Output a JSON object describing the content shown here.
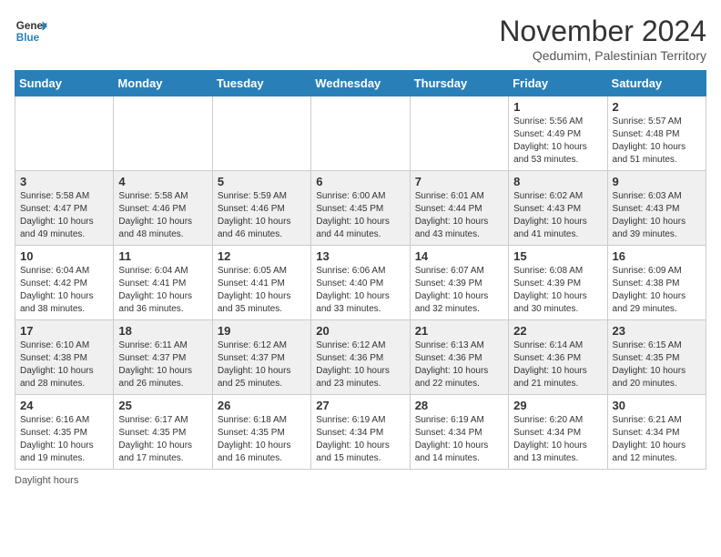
{
  "header": {
    "logo_general": "General",
    "logo_blue": "Blue",
    "month_year": "November 2024",
    "location": "Qedumim, Palestinian Territory"
  },
  "days_of_week": [
    "Sunday",
    "Monday",
    "Tuesday",
    "Wednesday",
    "Thursday",
    "Friday",
    "Saturday"
  ],
  "weeks": [
    [
      {
        "day": "",
        "info": ""
      },
      {
        "day": "",
        "info": ""
      },
      {
        "day": "",
        "info": ""
      },
      {
        "day": "",
        "info": ""
      },
      {
        "day": "",
        "info": ""
      },
      {
        "day": "1",
        "info": "Sunrise: 5:56 AM\nSunset: 4:49 PM\nDaylight: 10 hours\nand 53 minutes."
      },
      {
        "day": "2",
        "info": "Sunrise: 5:57 AM\nSunset: 4:48 PM\nDaylight: 10 hours\nand 51 minutes."
      }
    ],
    [
      {
        "day": "3",
        "info": "Sunrise: 5:58 AM\nSunset: 4:47 PM\nDaylight: 10 hours\nand 49 minutes."
      },
      {
        "day": "4",
        "info": "Sunrise: 5:58 AM\nSunset: 4:46 PM\nDaylight: 10 hours\nand 48 minutes."
      },
      {
        "day": "5",
        "info": "Sunrise: 5:59 AM\nSunset: 4:46 PM\nDaylight: 10 hours\nand 46 minutes."
      },
      {
        "day": "6",
        "info": "Sunrise: 6:00 AM\nSunset: 4:45 PM\nDaylight: 10 hours\nand 44 minutes."
      },
      {
        "day": "7",
        "info": "Sunrise: 6:01 AM\nSunset: 4:44 PM\nDaylight: 10 hours\nand 43 minutes."
      },
      {
        "day": "8",
        "info": "Sunrise: 6:02 AM\nSunset: 4:43 PM\nDaylight: 10 hours\nand 41 minutes."
      },
      {
        "day": "9",
        "info": "Sunrise: 6:03 AM\nSunset: 4:43 PM\nDaylight: 10 hours\nand 39 minutes."
      }
    ],
    [
      {
        "day": "10",
        "info": "Sunrise: 6:04 AM\nSunset: 4:42 PM\nDaylight: 10 hours\nand 38 minutes."
      },
      {
        "day": "11",
        "info": "Sunrise: 6:04 AM\nSunset: 4:41 PM\nDaylight: 10 hours\nand 36 minutes."
      },
      {
        "day": "12",
        "info": "Sunrise: 6:05 AM\nSunset: 4:41 PM\nDaylight: 10 hours\nand 35 minutes."
      },
      {
        "day": "13",
        "info": "Sunrise: 6:06 AM\nSunset: 4:40 PM\nDaylight: 10 hours\nand 33 minutes."
      },
      {
        "day": "14",
        "info": "Sunrise: 6:07 AM\nSunset: 4:39 PM\nDaylight: 10 hours\nand 32 minutes."
      },
      {
        "day": "15",
        "info": "Sunrise: 6:08 AM\nSunset: 4:39 PM\nDaylight: 10 hours\nand 30 minutes."
      },
      {
        "day": "16",
        "info": "Sunrise: 6:09 AM\nSunset: 4:38 PM\nDaylight: 10 hours\nand 29 minutes."
      }
    ],
    [
      {
        "day": "17",
        "info": "Sunrise: 6:10 AM\nSunset: 4:38 PM\nDaylight: 10 hours\nand 28 minutes."
      },
      {
        "day": "18",
        "info": "Sunrise: 6:11 AM\nSunset: 4:37 PM\nDaylight: 10 hours\nand 26 minutes."
      },
      {
        "day": "19",
        "info": "Sunrise: 6:12 AM\nSunset: 4:37 PM\nDaylight: 10 hours\nand 25 minutes."
      },
      {
        "day": "20",
        "info": "Sunrise: 6:12 AM\nSunset: 4:36 PM\nDaylight: 10 hours\nand 23 minutes."
      },
      {
        "day": "21",
        "info": "Sunrise: 6:13 AM\nSunset: 4:36 PM\nDaylight: 10 hours\nand 22 minutes."
      },
      {
        "day": "22",
        "info": "Sunrise: 6:14 AM\nSunset: 4:36 PM\nDaylight: 10 hours\nand 21 minutes."
      },
      {
        "day": "23",
        "info": "Sunrise: 6:15 AM\nSunset: 4:35 PM\nDaylight: 10 hours\nand 20 minutes."
      }
    ],
    [
      {
        "day": "24",
        "info": "Sunrise: 6:16 AM\nSunset: 4:35 PM\nDaylight: 10 hours\nand 19 minutes."
      },
      {
        "day": "25",
        "info": "Sunrise: 6:17 AM\nSunset: 4:35 PM\nDaylight: 10 hours\nand 17 minutes."
      },
      {
        "day": "26",
        "info": "Sunrise: 6:18 AM\nSunset: 4:35 PM\nDaylight: 10 hours\nand 16 minutes."
      },
      {
        "day": "27",
        "info": "Sunrise: 6:19 AM\nSunset: 4:34 PM\nDaylight: 10 hours\nand 15 minutes."
      },
      {
        "day": "28",
        "info": "Sunrise: 6:19 AM\nSunset: 4:34 PM\nDaylight: 10 hours\nand 14 minutes."
      },
      {
        "day": "29",
        "info": "Sunrise: 6:20 AM\nSunset: 4:34 PM\nDaylight: 10 hours\nand 13 minutes."
      },
      {
        "day": "30",
        "info": "Sunrise: 6:21 AM\nSunset: 4:34 PM\nDaylight: 10 hours\nand 12 minutes."
      }
    ]
  ],
  "footer": {
    "note": "Daylight hours"
  }
}
